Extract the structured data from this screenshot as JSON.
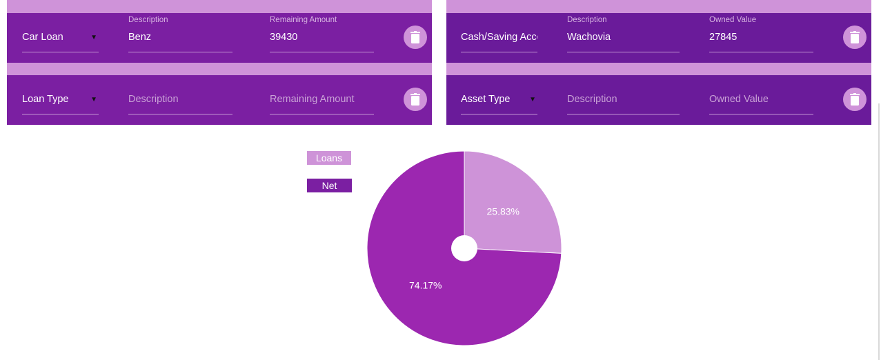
{
  "liabilities": {
    "rows": [
      {
        "type": "Car Loan",
        "description_label": "Description",
        "description": "Benz",
        "amount_label": "Remaining Amount",
        "amount": "39430"
      },
      {
        "type": "Loan Type",
        "description_placeholder": "Description",
        "amount_placeholder": "Remaining Amount"
      }
    ]
  },
  "assets": {
    "rows": [
      {
        "type": "Cash/Saving Acco",
        "description_label": "Description",
        "description": "Wachovia",
        "value_label": "Owned Value",
        "value": "27845"
      },
      {
        "type": "Asset Type",
        "description_placeholder": "Description",
        "value_placeholder": "Owned Value"
      }
    ]
  },
  "colors": {
    "row_left": "#7b1fa2",
    "row_right": "#6a1b9a",
    "panel_bg": "#ce93d8",
    "loans": "#ce93d8",
    "net_worth": "#9c27b0",
    "net_worth_legend": "#7b1fa2"
  },
  "icons": {
    "delete": "trash-icon",
    "dropdown": "caret-down-icon"
  },
  "chart_data": {
    "type": "pie",
    "title": "",
    "legend": [
      "Loans",
      "Net Worth"
    ],
    "legend_position": "left",
    "series": [
      {
        "name": "Loans",
        "value": 25.83,
        "label": "25.83%"
      },
      {
        "name": "Net Worth",
        "value": 74.17,
        "label": "74.17%"
      }
    ]
  }
}
